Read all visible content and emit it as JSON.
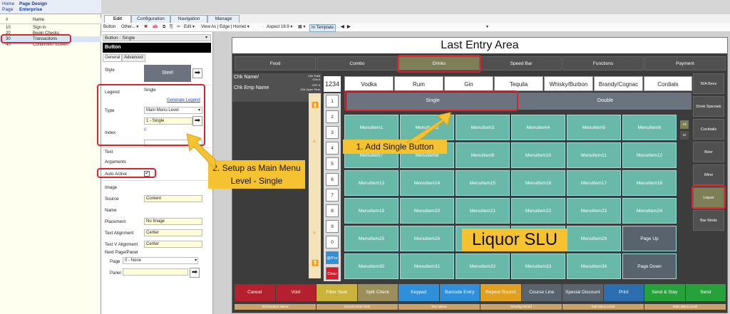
{
  "home_tabs": {
    "home": "Home",
    "page": "Page",
    "page_design": "Page Design",
    "enterprise": "Enterprise"
  },
  "list": {
    "headers": [
      "#",
      "Name"
    ],
    "rows": [
      {
        "num": "10",
        "name": "Sign In"
      },
      {
        "num": "20",
        "name": "Begin Checks"
      },
      {
        "num": "30",
        "name": "Transactions"
      },
      {
        "num": "40",
        "name": "Condiment Screen"
      }
    ],
    "selected_index": 2
  },
  "tabs": [
    "Edit",
    "Configuration",
    "Navigation",
    "Manage"
  ],
  "toolbar": {
    "button": "Button",
    "other": "Other... ▾",
    "ab": "ab",
    "edit": "Edit ▾",
    "view_as": "View As | Edge | Hornet ▾",
    "aspect": "Aspect 16:9 ▾",
    "grid": "▦ ▾",
    "in_template": "In Template"
  },
  "props": {
    "header": "Button : Single",
    "dark_title": "Button",
    "tabs": [
      "General",
      "Advanced"
    ],
    "style_label": "Style",
    "style_value": "Steel",
    "legend_label": "Legend",
    "legend_value": "Single",
    "generate_legend": "Generate Legend",
    "type_label": "Type",
    "type_value": "Main Menu Level",
    "type_sub": "1 - Single",
    "index_label": "Index",
    "index_value": "0",
    "text_label": "Text",
    "arguments_label": "Arguments",
    "auto_active_label": "Auto Active",
    "image_label": "Image",
    "source_label": "Source",
    "source_value": "Content",
    "name_label": "Name",
    "placement_label": "Placement",
    "placement_value": "No Image",
    "text_align_label": "Text Alignment",
    "text_align_value": "Center",
    "text_valign_label": "Text V Alignment",
    "text_valign_value": "Center",
    "next_page_label": "Next Page/Panel",
    "page_label": "Page",
    "page_value": "0 - None",
    "panel_label": "Panel"
  },
  "stage": {
    "title": "Last Entry Area",
    "categories": [
      "Food",
      "Combo",
      "Drinks",
      "Speed Bar",
      "Functions",
      "Payment"
    ],
    "selected_category": 2,
    "check": {
      "name": "Chk Name/",
      "emp": "Chk Emp Name",
      "top": "Chk Tbl/#",
      "num": "Chk #",
      "gst": "GST #",
      "open": "Chk Open Time"
    },
    "num_display": "1234",
    "numbers": [
      "1",
      "2",
      "3",
      "4",
      "5",
      "6",
      "7",
      "8",
      "9",
      "0",
      "@/For",
      "Clear"
    ],
    "liquors": [
      "Vodka",
      "Rum",
      "Gin",
      "Tequila",
      "Whisky/Burbon",
      "Brandy/Cognac",
      "Cordials"
    ],
    "sizes": [
      "Single",
      "Double"
    ],
    "menu_items": [
      [
        "MenuItem1",
        "MenuItem2",
        "MenuItem3",
        "MenuItem4",
        "MenuItem5",
        "MenuItem6"
      ],
      [
        "MenuItem7",
        "MenuItem8",
        "MenuItem9",
        "MenuItem10",
        "MenuItem11",
        "MenuItem12"
      ],
      [
        "MenuItem13",
        "MenuItem14",
        "MenuItem15",
        "MenuItem16",
        "MenuItem17",
        "MenuItem18"
      ],
      [
        "MenuItem19",
        "MenuItem20",
        "MenuItem21",
        "MenuItem22",
        "MenuItem23",
        "MenuItem24"
      ],
      [
        "MenuItem25",
        "MenuItem26",
        "MenuItem27",
        "MenuItem28",
        "MenuItem29",
        "Page Up"
      ],
      [
        "MenuItem30",
        "MenuItem31",
        "MenuItem32",
        "MenuItem33",
        "MenuItem34",
        "Page Down"
      ]
    ],
    "side_small": [
      "All",
      "M"
    ],
    "side": [
      "N/A Bevs",
      "Drink Specials",
      "Cocktails",
      "Beer",
      "Wine",
      "Liquor",
      "Bar Mods"
    ],
    "selected_side": 5,
    "bottom": [
      {
        "label": "Cancel",
        "color": "#b5202e"
      },
      {
        "label": "Void",
        "color": "#b5202e"
      },
      {
        "label": "Filter Seat",
        "color": "#c9b33a"
      },
      {
        "label": "Split Check",
        "color": "#9a8f5a"
      },
      {
        "label": "Keypad",
        "color": "#2f8fd8"
      },
      {
        "label": "Barcode Entry",
        "color": "#2f8fd8"
      },
      {
        "label": "Repeat Round",
        "color": "#e0a020"
      },
      {
        "label": "Course Line",
        "color": "#58636e"
      },
      {
        "label": "Special Discount",
        "color": "#58636e"
      },
      {
        "label": "Print",
        "color": "#2b6fb0"
      },
      {
        "label": "Send & Stay",
        "color": "#27a23a"
      },
      {
        "label": "Send",
        "color": "#27a23a"
      }
    ],
    "footer": [
      "Workstation Name",
      "Current Date Time",
      "Rvc Name",
      "Serving Period",
      "Sub Menu Level",
      "Main Menu Level"
    ]
  },
  "callouts": {
    "add_single": "1. Add Single Button",
    "setup": "2. Setup as Main Menu Level - Single",
    "liquor_slu": "Liquor SLU"
  }
}
